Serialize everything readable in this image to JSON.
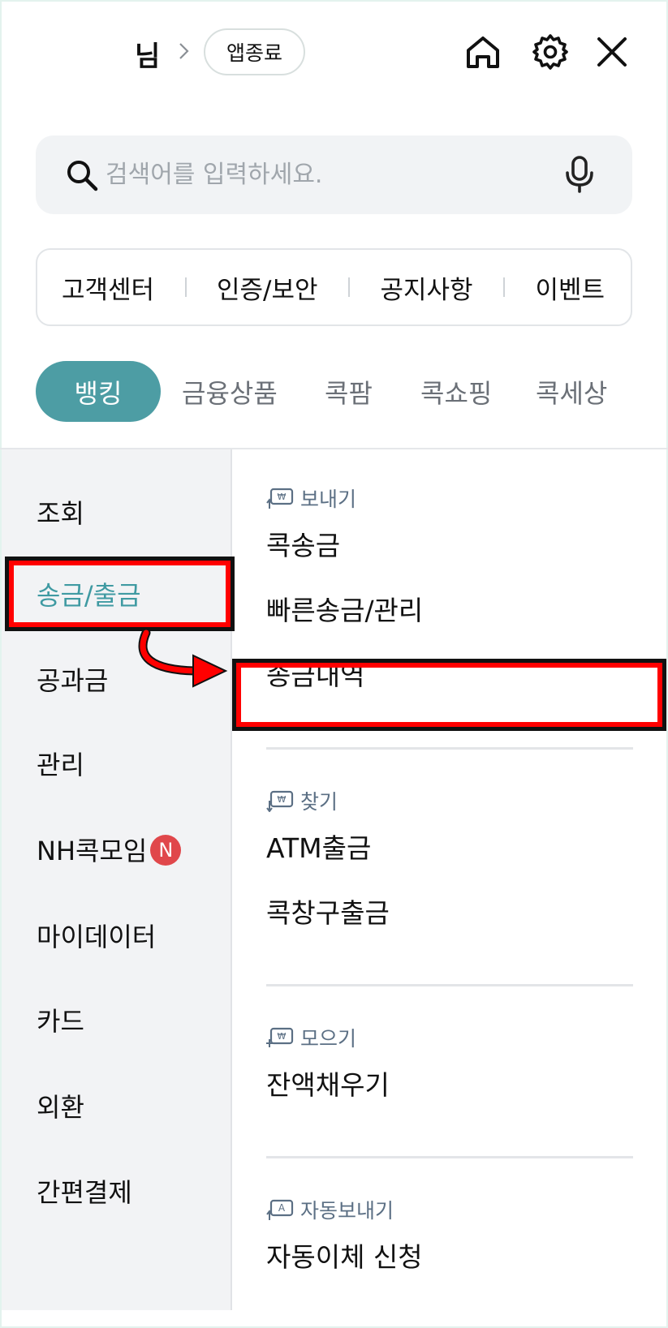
{
  "header": {
    "user_name": "님",
    "exit_label": "앱종료",
    "icons": [
      "home-icon",
      "gear-icon",
      "close-icon"
    ]
  },
  "search": {
    "placeholder": "검색어를 입력하세요.",
    "value": ""
  },
  "quick_links": [
    "고객센터",
    "인증/보안",
    "공지사항",
    "이벤트"
  ],
  "tabs": [
    {
      "label": "뱅킹",
      "active": true
    },
    {
      "label": "금융상품",
      "active": false
    },
    {
      "label": "콕팜",
      "active": false
    },
    {
      "label": "콕쇼핑",
      "active": false
    },
    {
      "label": "콕세상",
      "active": false
    }
  ],
  "sidebar": {
    "items": [
      {
        "label": "조회",
        "active": false
      },
      {
        "label": "송금/출금",
        "active": true
      },
      {
        "label": "공과금",
        "active": false
      },
      {
        "label": "관리",
        "active": false
      },
      {
        "label": "NH콕모임",
        "active": false,
        "badge": "N"
      },
      {
        "label": "마이데이터",
        "active": false
      },
      {
        "label": "카드",
        "active": false
      },
      {
        "label": "외환",
        "active": false
      },
      {
        "label": "간편결제",
        "active": false
      }
    ]
  },
  "sections": [
    {
      "title": "보내기",
      "icon": "send-money-icon",
      "items": [
        "콕송금",
        "빠른송금/관리",
        "송금내역"
      ]
    },
    {
      "title": "찾기",
      "icon": "withdraw-money-icon",
      "items": [
        "ATM출금",
        "콕창구출금"
      ]
    },
    {
      "title": "모으기",
      "icon": "save-money-icon",
      "items": [
        "잔액채우기"
      ]
    },
    {
      "title": "자동보내기",
      "icon": "auto-send-icon",
      "items": [
        "자동이체 신청"
      ]
    }
  ],
  "colors": {
    "accent": "#4d9da4",
    "active_text": "#3f9aa2",
    "highlight": "#ff0000",
    "badge": "#e0474b"
  }
}
